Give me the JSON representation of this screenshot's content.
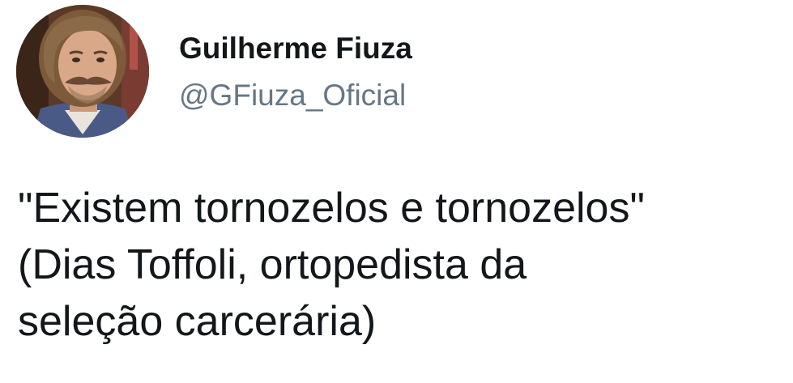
{
  "author": {
    "display_name": "Guilherme Fiuza",
    "handle": "@GFiuza_Oficial",
    "avatar_icon": "profile-photo"
  },
  "tweet": {
    "lines": [
      "\"Existem tornozelos e tornozelos\"",
      "(Dias Toffoli, ortopedista da",
      "seleção carcerária)"
    ]
  },
  "colors": {
    "name": "#14171a",
    "handle": "#657786",
    "text": "#14171a",
    "background": "#ffffff"
  }
}
